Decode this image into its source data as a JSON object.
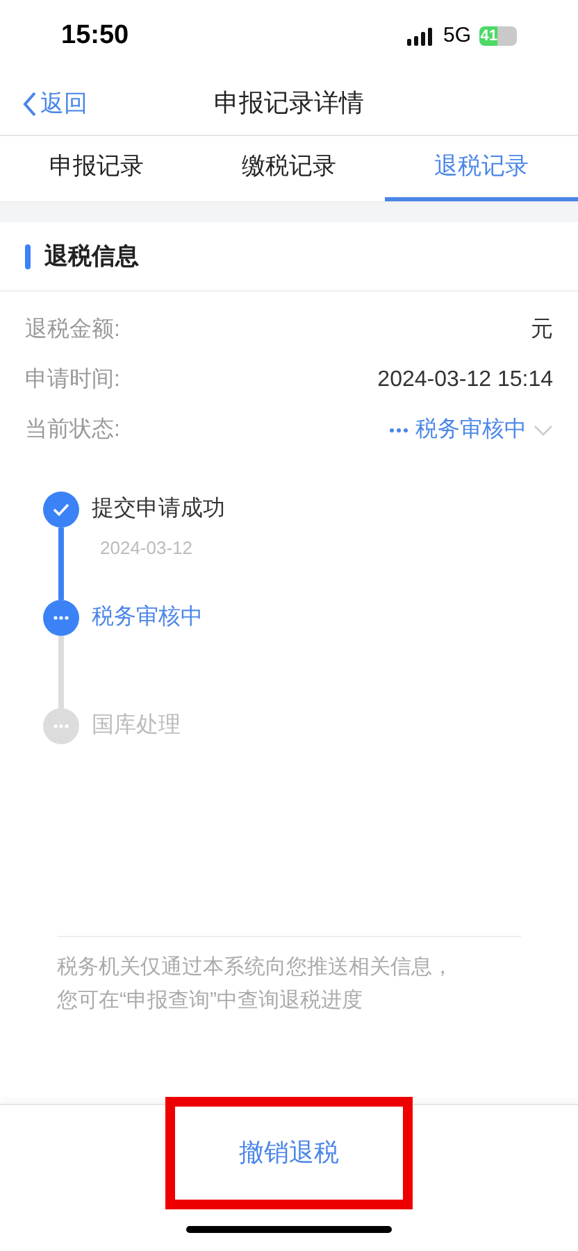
{
  "status_bar": {
    "time": "15:50",
    "network": "5G",
    "battery": "41"
  },
  "nav": {
    "back": "返回",
    "title": "申报记录详情"
  },
  "tabs": [
    {
      "label": "申报记录",
      "selected": false
    },
    {
      "label": "缴税记录",
      "selected": false
    },
    {
      "label": "退税记录",
      "selected": true
    }
  ],
  "section": {
    "title": "退税信息"
  },
  "fields": [
    {
      "label": "退税金额:",
      "value": "元",
      "kind": "text"
    },
    {
      "label": "申请时间:",
      "value": "2024-03-12 15:14",
      "kind": "text"
    },
    {
      "label": "当前状态:",
      "value": "税务审核中",
      "kind": "status"
    }
  ],
  "steps": [
    {
      "title": "提交申请成功",
      "date": "2024-03-12",
      "kind": "done"
    },
    {
      "title": "税务审核中",
      "kind": "current"
    },
    {
      "title": "国库处理",
      "kind": "pending"
    }
  ],
  "note": "税务机关仅通过本系统向您推送相关信息，您可在“申报查询”中查询退税进度",
  "action": {
    "label": "撤销退税",
    "highlighted": true
  }
}
